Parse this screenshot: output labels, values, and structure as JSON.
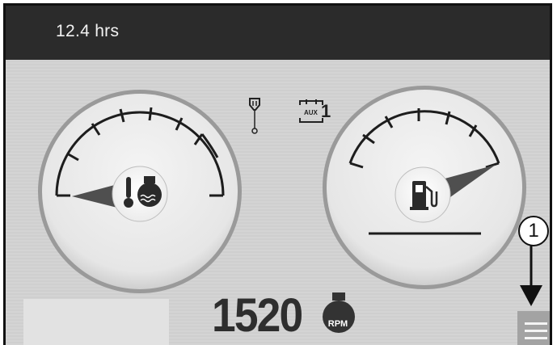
{
  "header": {
    "runtime": "12.4 hrs"
  },
  "indicators": {
    "glow_plug_icon": "glow-plug-icon",
    "aux_label": "AUX",
    "aux_number": "1"
  },
  "gauges": {
    "coolant": {
      "icon": "coolant-temperature-icon",
      "level": 0.0
    },
    "fuel": {
      "icon": "fuel-pump-icon",
      "level": 0.88
    }
  },
  "rpm": {
    "value": "1520",
    "unit": "RPM"
  },
  "menu": {
    "icon": "menu-icon"
  },
  "callout": {
    "number": "1"
  },
  "colors": {
    "header": "#2b2b2b",
    "background": "#d2d2d2",
    "needle": "#555555",
    "menu_button": "#a3a3a3"
  }
}
